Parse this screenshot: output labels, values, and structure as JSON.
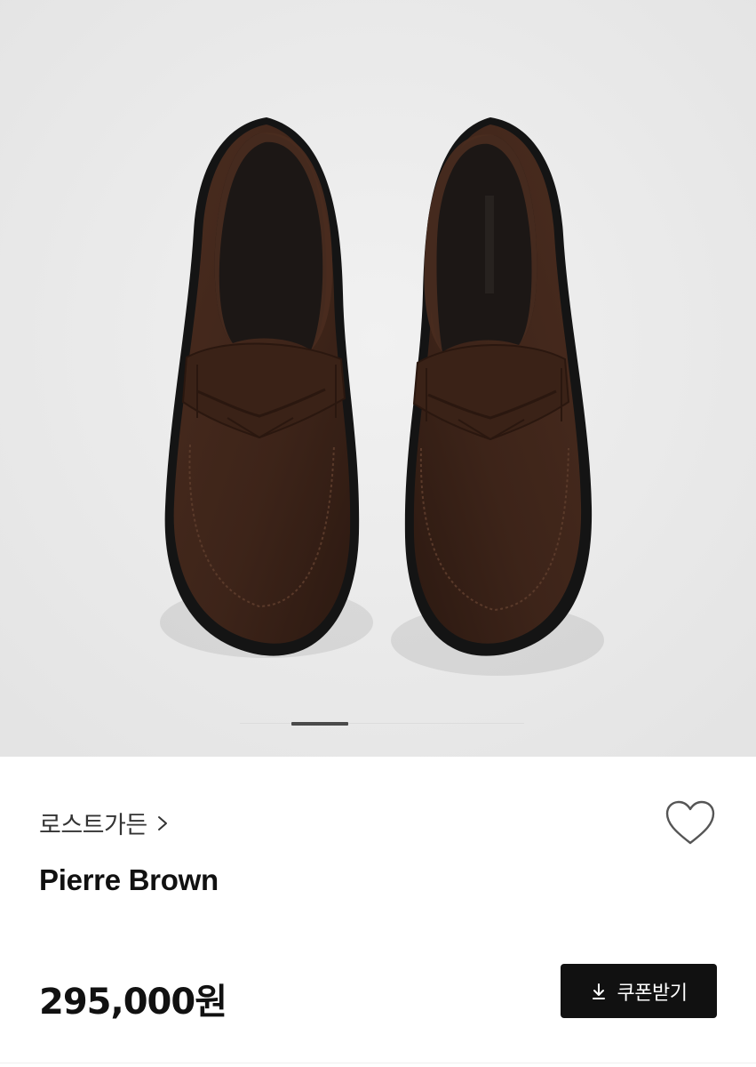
{
  "hero": {
    "image_description_icon": "loafer-shoes-image",
    "pager": {
      "total_slides": 5,
      "active_index": 1
    }
  },
  "product": {
    "brand": "로스트가든",
    "name": "Pierre Brown",
    "price": "295,000원"
  },
  "actions": {
    "like_icon": "heart-outline-icon",
    "coupon_label": "쿠폰받기",
    "coupon_icon": "download-icon"
  },
  "colors": {
    "hero_bg": "#ececec",
    "suede": "#3d2419",
    "button_bg": "#111111",
    "button_text": "#ffffff"
  }
}
